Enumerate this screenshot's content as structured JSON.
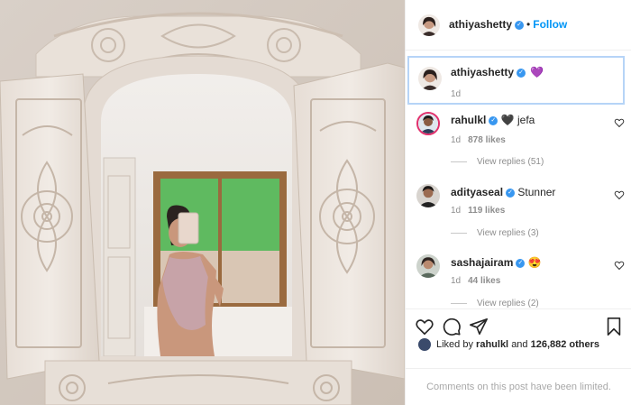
{
  "post": {
    "author": "athiyashetty",
    "follow_label": "Follow",
    "dot": "•"
  },
  "caption": {
    "username": "athiyashetty",
    "emoji": "💜",
    "time": "1d"
  },
  "comments": [
    {
      "username": "rahulkl",
      "text": "🖤 jefa",
      "time": "1d",
      "likes": "878 likes",
      "replies": "View replies (51)"
    },
    {
      "username": "adityaseal",
      "text": "Stunner",
      "time": "1d",
      "likes": "119 likes",
      "replies": "View replies (3)"
    },
    {
      "username": "sashajairam",
      "text": "😍",
      "time": "1d",
      "likes": "44 likes",
      "replies": "View replies (2)"
    }
  ],
  "likes_line": {
    "prefix": "Liked by",
    "user": "rahulkl",
    "connector": "and",
    "count": "126,882 others"
  },
  "footer": {
    "limited_text": "Comments on this post have been limited."
  },
  "colors": {
    "accent": "#0095f6",
    "verified": "#3897f0",
    "selected_border": "#b6d4f7"
  }
}
